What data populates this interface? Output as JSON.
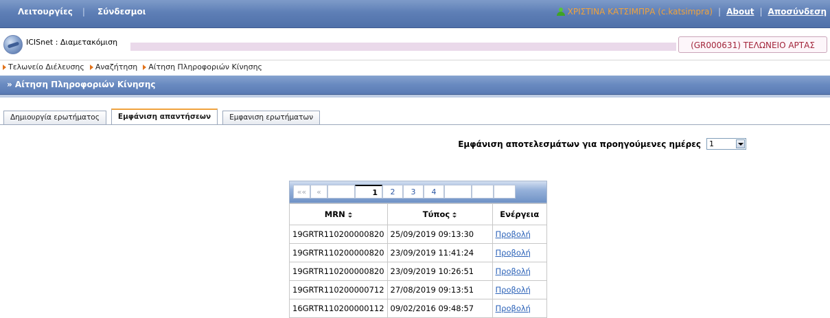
{
  "topbar": {
    "functions_label": "Λειτουργίες",
    "separator": "|",
    "links_label": "Σύνδεσμοι",
    "user_name": "ΧΡΙΣΤΙΝΑ ΚΑΤΣΙΜΠΡΑ (c.katsimpra)",
    "about_label": "About",
    "logout_label": "Αποσύνδεση"
  },
  "app": {
    "title": "ICISnet : Διαμετακόμιση",
    "office": "(GR000631) ΤΕΛΩΝΕΙΟ ΑΡΤΑΣ"
  },
  "breadcrumb": {
    "items": [
      "Τελωνείο Διέλευσης",
      "Αναζήτηση",
      "Αίτηση Πληροφοριών Κίνησης"
    ]
  },
  "section": {
    "title": "» Αίτηση Πληροφοριών Κίνησης"
  },
  "tabs": [
    {
      "label": "Δημιουργία ερωτήματος",
      "active": false
    },
    {
      "label": "Εμφάνιση απαντήσεων",
      "active": true
    },
    {
      "label": "Εμφανιση ερωτήματων",
      "active": false
    }
  ],
  "filter": {
    "label": "Εμφάνιση αποτελεσμάτων για προηγούμενες ημέρες",
    "value": "1"
  },
  "pager": {
    "first": "««",
    "prev": "«",
    "current": "1",
    "pages": [
      "2",
      "3",
      "4"
    ]
  },
  "table": {
    "columns": [
      "MRN",
      "Τύπος",
      "Ενέργεια"
    ],
    "rows": [
      {
        "mrn": "19GRTR110200000820",
        "type": "25/09/2019 09:13:30",
        "action": "Προβολή"
      },
      {
        "mrn": "19GRTR110200000820",
        "type": "23/09/2019 11:41:24",
        "action": "Προβολή"
      },
      {
        "mrn": "19GRTR110200000820",
        "type": "23/09/2019 10:26:51",
        "action": "Προβολή"
      },
      {
        "mrn": "19GRTR110200000712",
        "type": "27/08/2019 09:13:51",
        "action": "Προβολή"
      },
      {
        "mrn": "16GRTR110200000112",
        "type": "09/02/2016 09:48:57",
        "action": "Προβολή"
      }
    ]
  },
  "colors": {
    "bar_blue": "#5e7fb6",
    "user_orange": "#f0a23c",
    "office_red": "#a2243a",
    "breadcrumb_arrow": "#e2731b",
    "link_blue": "#2b62b8"
  }
}
